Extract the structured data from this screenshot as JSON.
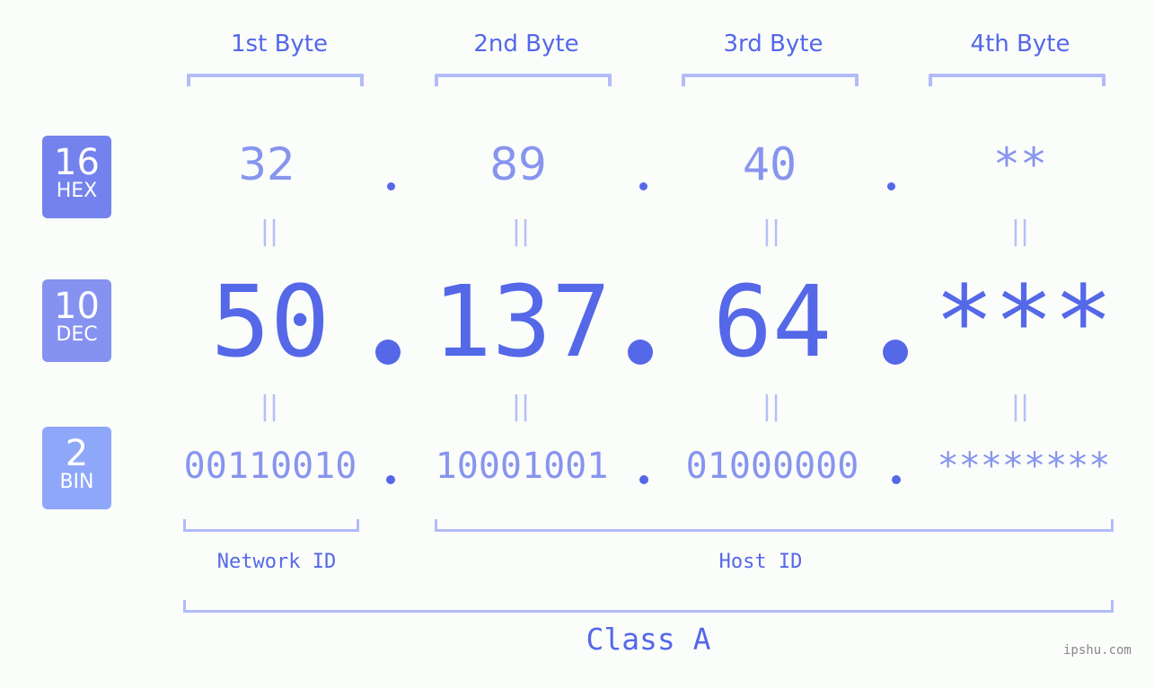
{
  "byte_headers": [
    "1st Byte",
    "2nd Byte",
    "3rd Byte",
    "4th Byte"
  ],
  "badges": [
    {
      "num": "16",
      "label": "HEX",
      "color": "#7382ec"
    },
    {
      "num": "10",
      "label": "DEC",
      "color": "#8592f0"
    },
    {
      "num": "2",
      "label": "BIN",
      "color": "#8ea7f9"
    }
  ],
  "hex_values": [
    "32",
    "89",
    "40",
    "**"
  ],
  "dec_values": [
    "50",
    "137",
    "64",
    "***"
  ],
  "bin_values": [
    "00110010",
    "10001001",
    "01000000",
    "********"
  ],
  "equals_symbol": "||",
  "network_label": "Network ID",
  "host_label": "Host ID",
  "class_label": "Class A",
  "watermark": "ipshu.com",
  "colors": {
    "accent": "#5468e8",
    "light": "#8795ee",
    "bracket": "#b2bcf7",
    "background": "#fbfdfb"
  }
}
